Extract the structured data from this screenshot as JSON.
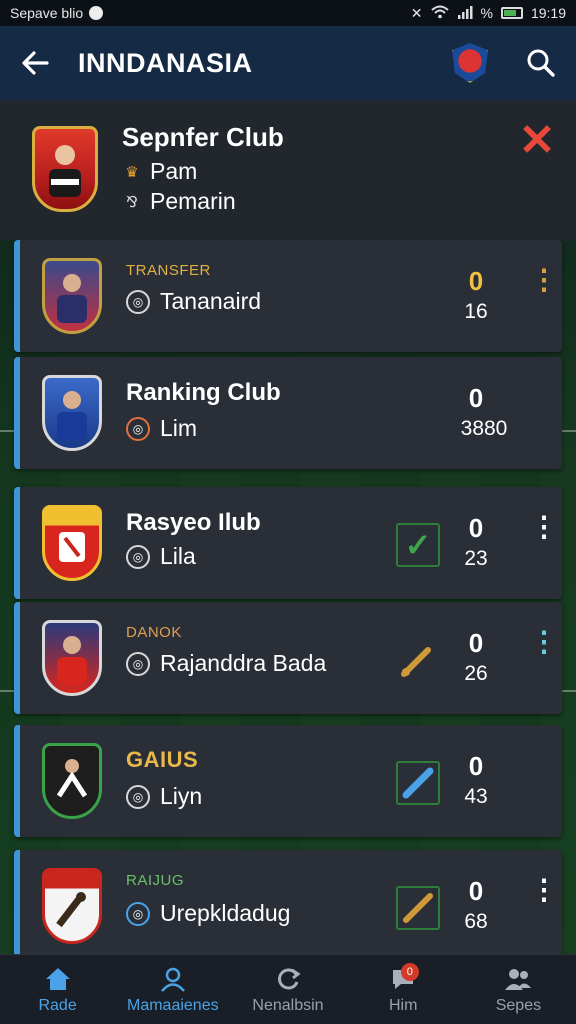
{
  "status_bar": {
    "left_text": "Sepave blio",
    "battery_text": "%",
    "time": "19:19"
  },
  "app_bar": {
    "title": "INNDANASIA",
    "back_icon": "arrow-left-icon",
    "search_icon": "search-icon"
  },
  "club_header": {
    "name": "Sepnfer Club",
    "line1": "Pam",
    "line2": "Pemarin",
    "close_color": "#e8483a"
  },
  "cards": [
    {
      "eyebrow": "TRANSFER",
      "eyebrow_color": "#e0b040",
      "subtitle": "Tananaird",
      "score": "0",
      "score_color": "#f0c040",
      "count": "16",
      "more": "⋮",
      "more_color": "#e0a040"
    },
    {
      "name": "Ranking Club",
      "subtitle": "Lim",
      "score": "0",
      "count": "3880"
    },
    {
      "name": "Rasyeo Ilub",
      "subtitle": "Lila",
      "score": "0",
      "count": "23",
      "more": "⋮",
      "action": "check",
      "action_color": "#3fa34d"
    },
    {
      "eyebrow": "DANOK",
      "eyebrow_color": "#e0a050",
      "subtitle": "Rajanddra Bada",
      "score": "0",
      "count": "26",
      "more": "⋮",
      "more_color": "#6ad0e0",
      "action": "pencil",
      "action_color": "#d09a3a"
    },
    {
      "eyebrow": "GAIUS",
      "eyebrow_color": "#e8b848",
      "subtitle": "Liyn",
      "score": "0",
      "count": "43",
      "action": "ruler",
      "action_color": "#4aa3e8"
    },
    {
      "eyebrow": "RAIJUG",
      "eyebrow_color": "#6ac06a",
      "subtitle": "Urepkldadug",
      "score": "0",
      "count": "68",
      "more": "⋮",
      "action": "pencil",
      "action_color": "#d09a3a"
    }
  ],
  "bottom_nav": [
    {
      "label": "Rade",
      "icon": "home-icon"
    },
    {
      "label": "Mamaaienes",
      "icon": "user-icon"
    },
    {
      "label": "Nenalbsin",
      "icon": "refresh-icon"
    },
    {
      "label": "Him",
      "icon": "chat-icon",
      "badge": "0"
    },
    {
      "label": "Sepes",
      "icon": "people-icon"
    }
  ]
}
